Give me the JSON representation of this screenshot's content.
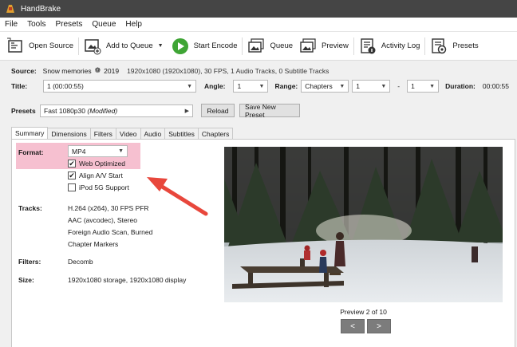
{
  "window": {
    "title": "HandBrake"
  },
  "menu": [
    "File",
    "Tools",
    "Presets",
    "Queue",
    "Help"
  ],
  "toolbar": {
    "open_source": "Open Source",
    "add_to_queue": "Add to Queue",
    "start_encode": "Start Encode",
    "queue": "Queue",
    "preview": "Preview",
    "activity_log": "Activity Log",
    "presets": "Presets"
  },
  "source": {
    "label": "Source:",
    "name": "Snow memories",
    "year": "2019",
    "info": "1920x1080 (1920x1080), 30 FPS, 1 Audio Tracks, 0 Subtitle Tracks"
  },
  "title_row": {
    "title_label": "Title:",
    "title_value": "1 (00:00:55)",
    "angle_label": "Angle:",
    "angle_value": "1",
    "range_label": "Range:",
    "range_type": "Chapters",
    "range_start": "1",
    "range_dash": "-",
    "range_end": "1",
    "duration_label": "Duration:",
    "duration_value": "00:00:55"
  },
  "presets_row": {
    "label": "Presets",
    "preset_name": "Fast 1080p30",
    "preset_modifier": "(Modified)",
    "reload": "Reload",
    "save_new": "Save New Preset"
  },
  "tabs": [
    "Summary",
    "Dimensions",
    "Filters",
    "Video",
    "Audio",
    "Subtitles",
    "Chapters"
  ],
  "summary": {
    "format_label": "Format:",
    "format_value": "MP4",
    "web_optimized": "Web Optimized",
    "web_optimized_checked": true,
    "align_av": "Align A/V Start",
    "align_av_checked": true,
    "ipod": "iPod 5G Support",
    "ipod_checked": false,
    "tracks_label": "Tracks:",
    "tracks": [
      "H.264 (x264), 30 FPS PFR",
      "AAC (avcodec), Stereo",
      "Foreign Audio Scan, Burned",
      "Chapter Markers"
    ],
    "filters_label": "Filters:",
    "filters_value": "Decomb",
    "size_label": "Size:",
    "size_value": "1920x1080 storage, 1920x1080 display"
  },
  "preview": {
    "caption": "Preview 2 of 10",
    "prev": "<",
    "next": ">"
  },
  "colors": {
    "titlebar": "#454545",
    "highlight": "#f6c0d0",
    "annotation_arrow": "#e8473c",
    "play_green": "#3fa535"
  }
}
